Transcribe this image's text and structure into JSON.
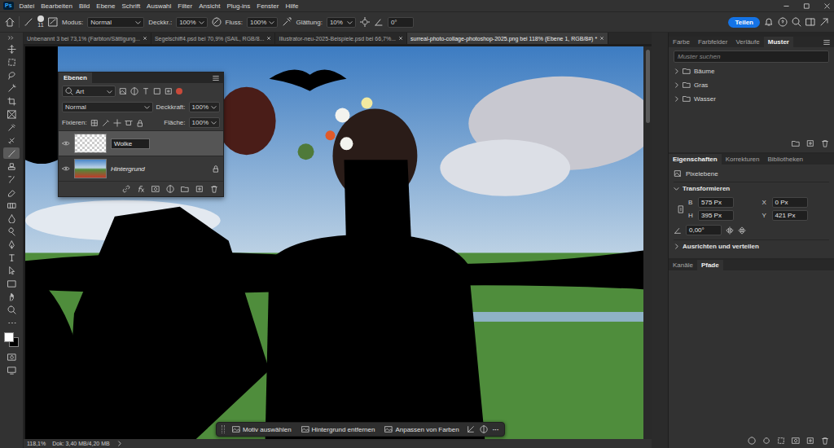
{
  "app": {
    "logo": "Ps"
  },
  "menu": [
    "Datei",
    "Bearbeiten",
    "Bild",
    "Ebene",
    "Schrift",
    "Auswahl",
    "Filter",
    "Ansicht",
    "Plug-ins",
    "Fenster",
    "Hilfe"
  ],
  "options": {
    "brush_size": "11",
    "mode_label": "Modus:",
    "mode": "Normal",
    "opacity_label": "Deckkr.:",
    "opacity": "100%",
    "flow_label": "Fluss:",
    "flow": "100%",
    "smoothing_label": "Glättung:",
    "smoothing": "10%",
    "angle": "0°",
    "share": "Teilen"
  },
  "tabs": [
    {
      "label": "Unbenannt 3 bei 73,1% (Farbton/Sättigung...",
      "selected": false
    },
    {
      "label": "Segelschiff4.psd bei 70,9% (SAIL, RGB/8...",
      "selected": false
    },
    {
      "label": "Illustrator-neu-2025-Beispiele.psd bei 66,7%...",
      "selected": false
    },
    {
      "label": "surreal-photo-collage-photoshop-2025.png bei 118% (Ebene 1, RGB/8#) *",
      "selected": true
    }
  ],
  "tools": [
    {
      "kind": "move",
      "selected": false
    },
    {
      "kind": "marquee",
      "selected": false
    },
    {
      "kind": "lasso",
      "selected": false
    },
    {
      "kind": "wand",
      "selected": false
    },
    {
      "kind": "crop",
      "selected": false
    },
    {
      "kind": "frame",
      "selected": false
    },
    {
      "kind": "eyedropper",
      "selected": false
    },
    {
      "kind": "heal",
      "selected": false
    },
    {
      "kind": "brush",
      "selected": true
    },
    {
      "kind": "stamp",
      "selected": false
    },
    {
      "kind": "history",
      "selected": false
    },
    {
      "kind": "eraser",
      "selected": false
    },
    {
      "kind": "gradient",
      "selected": false
    },
    {
      "kind": "blur",
      "selected": false
    },
    {
      "kind": "dodge",
      "selected": false
    },
    {
      "kind": "pen",
      "selected": false
    },
    {
      "kind": "type",
      "selected": false
    },
    {
      "kind": "pathselect",
      "selected": false
    },
    {
      "kind": "shape",
      "selected": false
    },
    {
      "kind": "hand",
      "selected": false
    },
    {
      "kind": "zoom",
      "selected": false
    },
    {
      "kind": "more",
      "selected": false
    }
  ],
  "layers_panel": {
    "title": "Ebenen",
    "filter": "Art",
    "blend": "Normal",
    "opacity_label": "Deckkraft:",
    "opacity": "100%",
    "lock_label": "Fixieren:",
    "fill_label": "Fläche:",
    "fill": "100%",
    "layers": [
      {
        "name": "Wolke",
        "selected": true,
        "visible": true,
        "italic": false,
        "locked": false,
        "editing": true,
        "kind": "transparent"
      },
      {
        "name": "Hintergrund",
        "selected": false,
        "visible": true,
        "italic": true,
        "locked": true,
        "editing": false,
        "kind": "photo"
      }
    ]
  },
  "patterns_panel": {
    "tabs": [
      {
        "label": "Farbe",
        "selected": false
      },
      {
        "label": "Farbfelder",
        "selected": false
      },
      {
        "label": "Verläufe",
        "selected": false
      },
      {
        "label": "Muster",
        "selected": true
      }
    ],
    "search_placeholder": "Muster suchen",
    "groups": [
      {
        "name": "Bäume",
        "expanded": false
      },
      {
        "name": "Gras",
        "expanded": false
      },
      {
        "name": "Wasser",
        "expanded": false
      }
    ]
  },
  "properties_panel": {
    "tabs": [
      {
        "label": "Eigenschaften",
        "selected": true
      },
      {
        "label": "Korrekturen",
        "selected": false
      },
      {
        "label": "Bibliotheken",
        "selected": false
      }
    ],
    "layer_type": "Pixelebene",
    "transform_title": "Transformieren",
    "fields": [
      {
        "label": "B",
        "value": "575 Px"
      },
      {
        "label": "X",
        "value": "0 Px"
      },
      {
        "label": "H",
        "value": "395 Px"
      },
      {
        "label": "Y",
        "value": "421 Px"
      }
    ],
    "angle": "0,00°",
    "align_title": "Ausrichten und verteilen"
  },
  "bottom_panel": {
    "tabs": [
      {
        "label": "Kanäle",
        "selected": false
      },
      {
        "label": "Pfade",
        "selected": true
      }
    ]
  },
  "task_bar": {
    "buttons": [
      "Motiv auswählen",
      "Hintergrund entfernen",
      "Anpassen von Farben"
    ],
    "more": "···"
  },
  "status_bar": {
    "zoom": "118,1%",
    "doc": "Dok: 3,40 MB/4,20 MB"
  }
}
